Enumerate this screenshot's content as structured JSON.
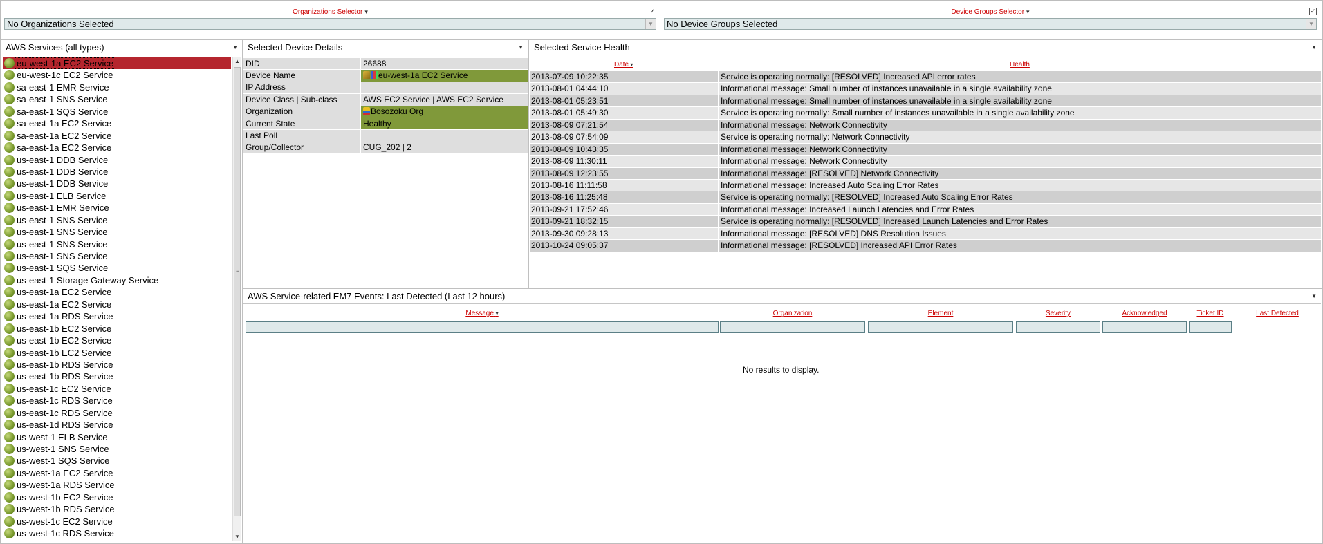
{
  "org_selector": {
    "title": "Organizations Selector",
    "value": "No Organizations Selected"
  },
  "group_selector": {
    "title": "Device Groups Selector",
    "value": "No Device Groups Selected"
  },
  "services_panel": {
    "title": "AWS Services (all types)",
    "items": [
      "eu-west-1a EC2 Service",
      "eu-west-1c EC2 Service",
      "sa-east-1 EMR Service",
      "sa-east-1 SNS Service",
      "sa-east-1 SQS Service",
      "sa-east-1a EC2 Service",
      "sa-east-1a EC2 Service",
      "sa-east-1a EC2 Service",
      "us-east-1 DDB Service",
      "us-east-1 DDB Service",
      "us-east-1 DDB Service",
      "us-east-1 ELB Service",
      "us-east-1 EMR Service",
      "us-east-1 SNS Service",
      "us-east-1 SNS Service",
      "us-east-1 SNS Service",
      "us-east-1 SNS Service",
      "us-east-1 SQS Service",
      "us-east-1 Storage Gateway Service",
      "us-east-1a EC2 Service",
      "us-east-1a EC2 Service",
      "us-east-1a RDS Service",
      "us-east-1b EC2 Service",
      "us-east-1b EC2 Service",
      "us-east-1b EC2 Service",
      "us-east-1b RDS Service",
      "us-east-1b RDS Service",
      "us-east-1c EC2 Service",
      "us-east-1c RDS Service",
      "us-east-1c RDS Service",
      "us-east-1d RDS Service",
      "us-west-1 ELB Service",
      "us-west-1 SNS Service",
      "us-west-1 SQS Service",
      "us-west-1a EC2 Service",
      "us-west-1a RDS Service",
      "us-west-1b EC2 Service",
      "us-west-1b RDS Service",
      "us-west-1c EC2 Service",
      "us-west-1c RDS Service"
    ],
    "selected_index": 0
  },
  "device_panel": {
    "title": "Selected Device Details",
    "rows": [
      {
        "key": "DID",
        "value": "26688",
        "highlight": false
      },
      {
        "key": "Device Name",
        "value": "eu-west-1a EC2 Service",
        "highlight": true
      },
      {
        "key": "IP Address",
        "value": "",
        "highlight": false
      },
      {
        "key": "Device Class | Sub-class",
        "value": "AWS EC2 Service | AWS EC2 Service",
        "highlight": false
      },
      {
        "key": "Organization",
        "value": "Bosozoku Org",
        "highlight": true
      },
      {
        "key": "Current State",
        "value": "Healthy",
        "highlight": true
      },
      {
        "key": "Last Poll",
        "value": "",
        "highlight": false
      },
      {
        "key": "Group/Collector",
        "value": "CUG_202 | 2",
        "highlight": false
      }
    ]
  },
  "health_panel": {
    "title": "Selected Service Health",
    "col_date": "Date",
    "col_health": "Health",
    "rows": [
      {
        "date": "2013-07-09 10:22:35",
        "msg": "Service is operating normally: [RESOLVED] Increased API error rates"
      },
      {
        "date": "2013-08-01 04:44:10",
        "msg": "Informational message: Small number of instances unavailable in a single availability zone"
      },
      {
        "date": "2013-08-01 05:23:51",
        "msg": "Informational message: Small number of instances unavailable in a single availability zone"
      },
      {
        "date": "2013-08-01 05:49:30",
        "msg": "Service is operating normally: Small number of instances unavailable in a single availability zone"
      },
      {
        "date": "2013-08-09 07:21:54",
        "msg": "Informational message: Network Connectivity"
      },
      {
        "date": "2013-08-09 07:54:09",
        "msg": "Service is operating normally: Network Connectivity"
      },
      {
        "date": "2013-08-09 10:43:35",
        "msg": "Informational message: Network Connectivity"
      },
      {
        "date": "2013-08-09 11:30:11",
        "msg": "Informational message: Network Connectivity"
      },
      {
        "date": "2013-08-09 12:23:55",
        "msg": "Informational message: [RESOLVED] Network Connectivity"
      },
      {
        "date": "2013-08-16 11:11:58",
        "msg": "Informational message: Increased Auto Scaling Error Rates"
      },
      {
        "date": "2013-08-16 11:25:48",
        "msg": "Service is operating normally: [RESOLVED] Increased Auto Scaling Error Rates"
      },
      {
        "date": "2013-09-21 17:52:46",
        "msg": "Informational message: Increased Launch Latencies and Error Rates"
      },
      {
        "date": "2013-09-21 18:32:15",
        "msg": "Service is operating normally: [RESOLVED] Increased Launch Latencies and Error Rates"
      },
      {
        "date": "2013-09-30 09:28:13",
        "msg": "Informational message: [RESOLVED] DNS Resolution Issues"
      },
      {
        "date": "2013-10-24 09:05:37",
        "msg": "Informational message: [RESOLVED] Increased API Error Rates"
      }
    ]
  },
  "events_panel": {
    "title": "AWS Service-related EM7 Events: Last Detected (Last 12 hours)",
    "columns": [
      "Message",
      "Organization",
      "Element",
      "Severity",
      "Acknowledged",
      "Ticket ID",
      "Last Detected"
    ],
    "empty_text": "No results to display."
  },
  "icons": {
    "status": "green-ball-icon",
    "dropdown": "triangle-down-icon"
  }
}
